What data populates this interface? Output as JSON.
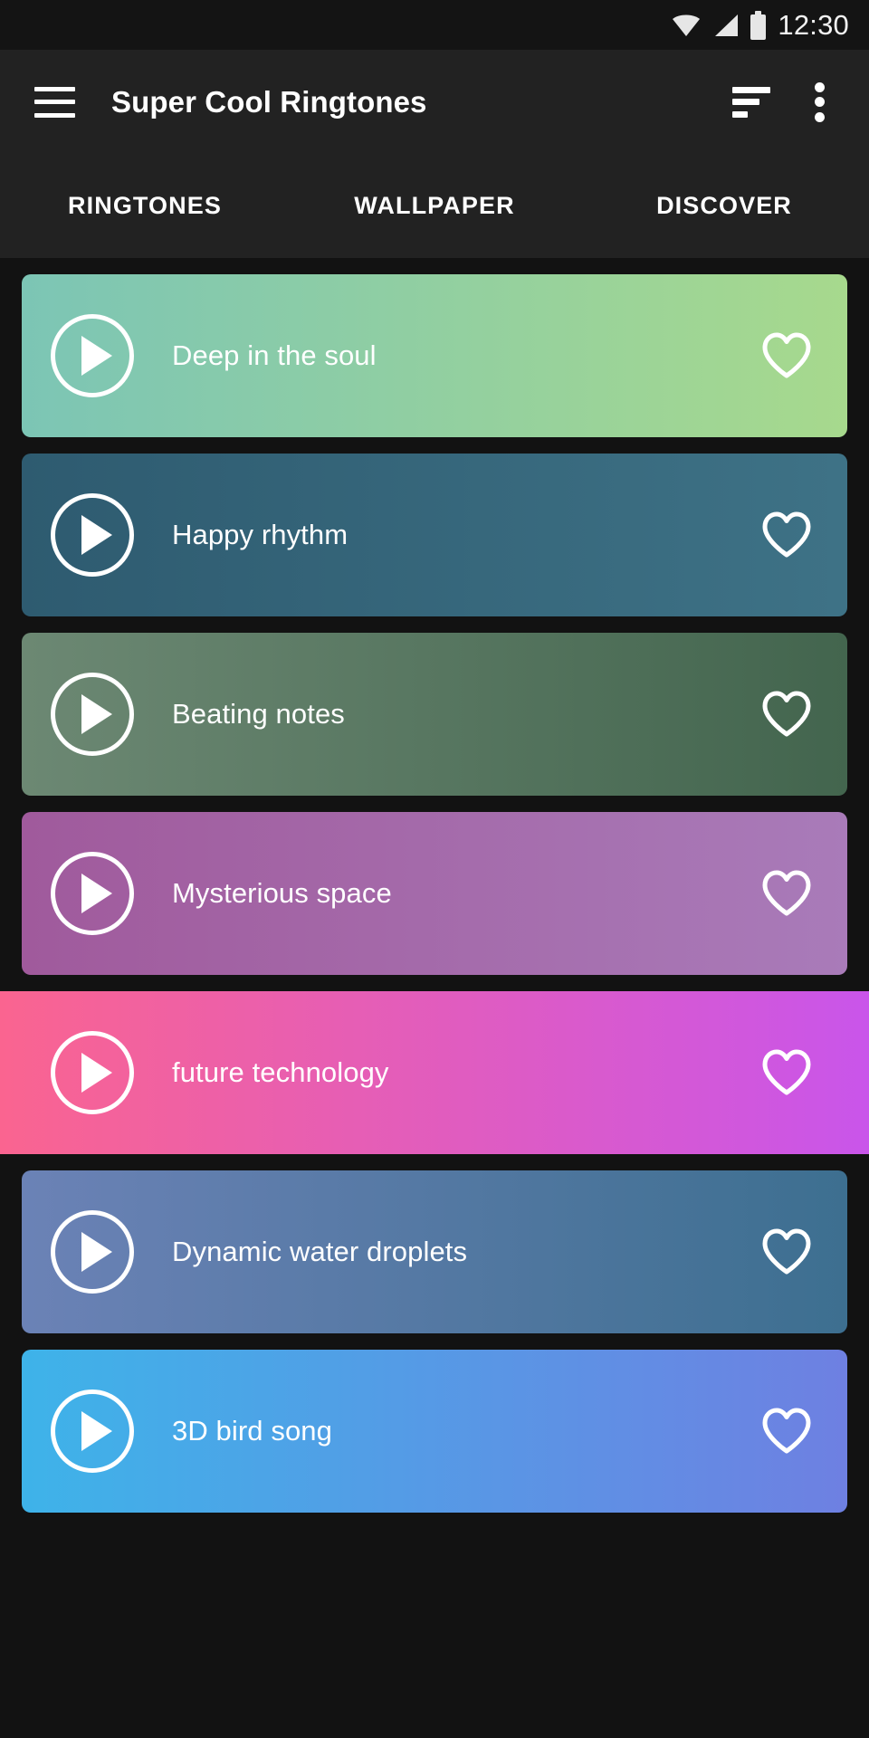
{
  "status_bar": {
    "time": "12:30",
    "icons": [
      "wifi-icon",
      "signal-icon",
      "battery-icon"
    ]
  },
  "app_bar": {
    "menu_icon": "hamburger-menu-icon",
    "title": "Super Cool Ringtones",
    "sort_icon": "sort-icon",
    "overflow_icon": "overflow-menu-icon"
  },
  "tabs": [
    {
      "label": "RINGTONES",
      "selected": true
    },
    {
      "label": "WALLPAPER",
      "selected": false
    },
    {
      "label": "DISCOVER",
      "selected": false
    }
  ],
  "ringtones": [
    {
      "title": "Deep in the soul",
      "gradient_from": "#7cc5b5",
      "gradient_to": "#a7d98d",
      "favorite": false,
      "full_bleed": false
    },
    {
      "title": "Happy rhythm",
      "gradient_from": "#2e5b70",
      "gradient_to": "#3e7286",
      "favorite": false,
      "full_bleed": false
    },
    {
      "title": "Beating notes",
      "gradient_from": "#6c8873",
      "gradient_to": "#43654e",
      "favorite": false,
      "full_bleed": false
    },
    {
      "title": "Mysterious space",
      "gradient_from": "#a05a9c",
      "gradient_to": "#a97bb9",
      "favorite": false,
      "full_bleed": false
    },
    {
      "title": "future technology",
      "gradient_from": "#fa6490",
      "gradient_to": "#c955ea",
      "favorite": false,
      "full_bleed": true
    },
    {
      "title": "Dynamic water droplets",
      "gradient_from": "#6b82b6",
      "gradient_to": "#3d6f90",
      "favorite": false,
      "full_bleed": false
    },
    {
      "title": "3D bird song",
      "gradient_from": "#3eb3e9",
      "gradient_to": "#6e80e2",
      "favorite": false,
      "full_bleed": false
    }
  ],
  "colors": {
    "status_bar_bg": "#141414",
    "app_bar_bg": "#222222",
    "page_bg": "#121212",
    "text_primary": "#ffffff"
  }
}
